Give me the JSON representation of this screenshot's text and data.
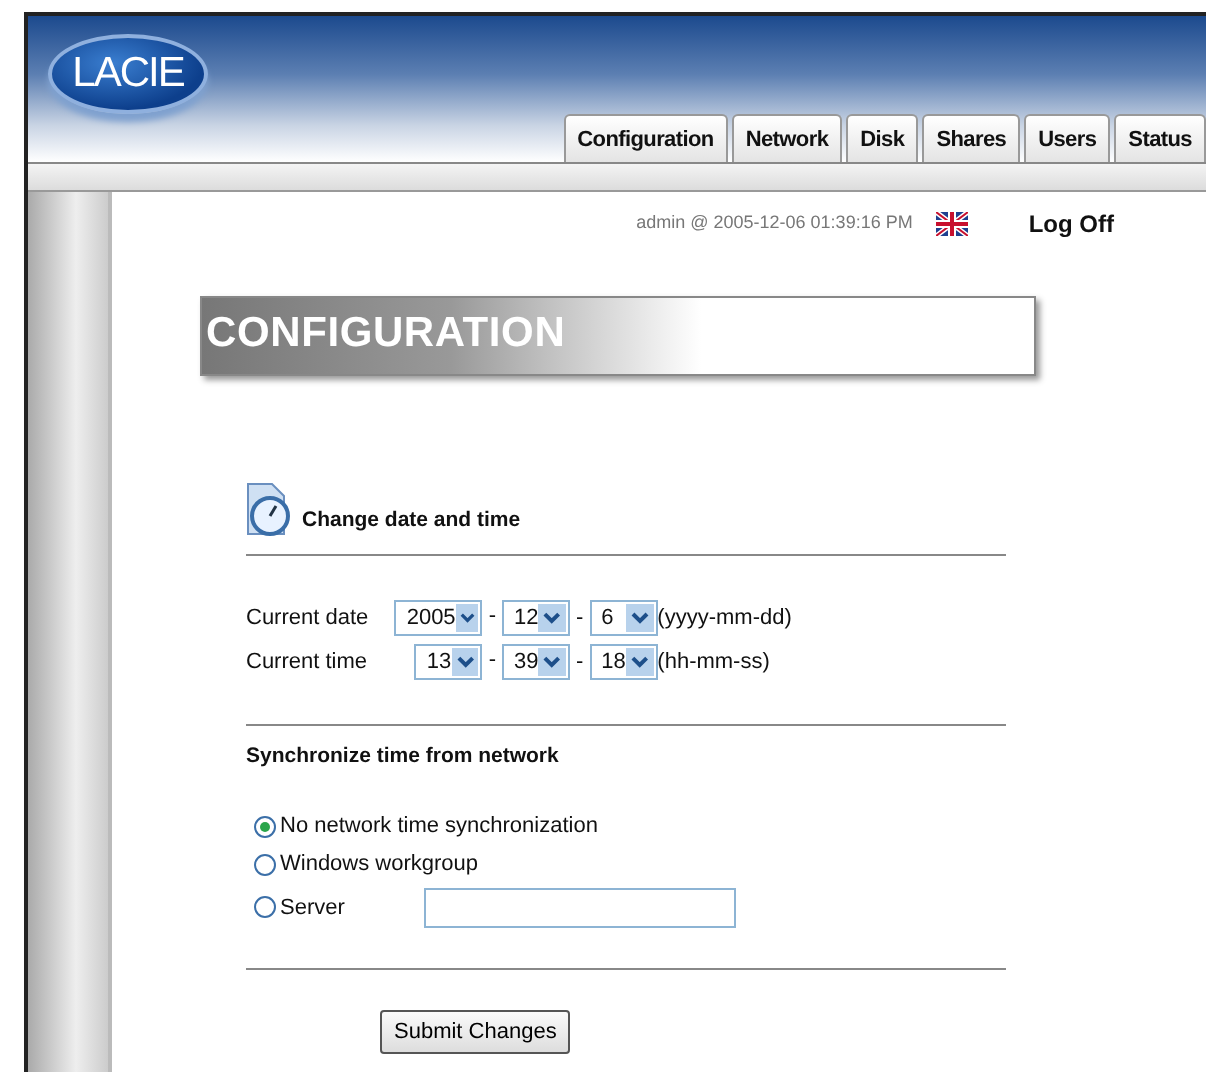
{
  "header": {
    "logo": "LACIE",
    "tabs": [
      {
        "label": "Configuration"
      },
      {
        "label": "Network"
      },
      {
        "label": "Disk"
      },
      {
        "label": "Shares"
      },
      {
        "label": "Users"
      },
      {
        "label": "Status"
      }
    ]
  },
  "user_bar": {
    "user": "admin @ 2005-12-06 01:39:16 PM",
    "logoff": "Log Off"
  },
  "page_title": "CONFIGURATION",
  "date_time": {
    "heading": "Change date and time",
    "rows": [
      {
        "label": "Current date",
        "fields": [
          {
            "value": "2005",
            "suffix": "-"
          },
          {
            "value": "12",
            "suffix": "-"
          },
          {
            "value": "6"
          }
        ],
        "format": "(yyyy-mm-dd)"
      },
      {
        "label": "Current time",
        "fields": [
          {
            "value": "13",
            "suffix": "-"
          },
          {
            "value": "39",
            "suffix": "-"
          },
          {
            "value": "18"
          }
        ],
        "format": "(hh-mm-ss)"
      }
    ]
  },
  "sync": {
    "heading": "Synchronize time from network",
    "options": [
      {
        "label": "No network time synchronization",
        "selected": true,
        "kind": "plain"
      },
      {
        "label": "Windows workgroup",
        "selected": false,
        "kind": "plain"
      },
      {
        "label": "Server",
        "selected": false,
        "kind": "field"
      }
    ]
  },
  "submit": "Submit Changes"
}
